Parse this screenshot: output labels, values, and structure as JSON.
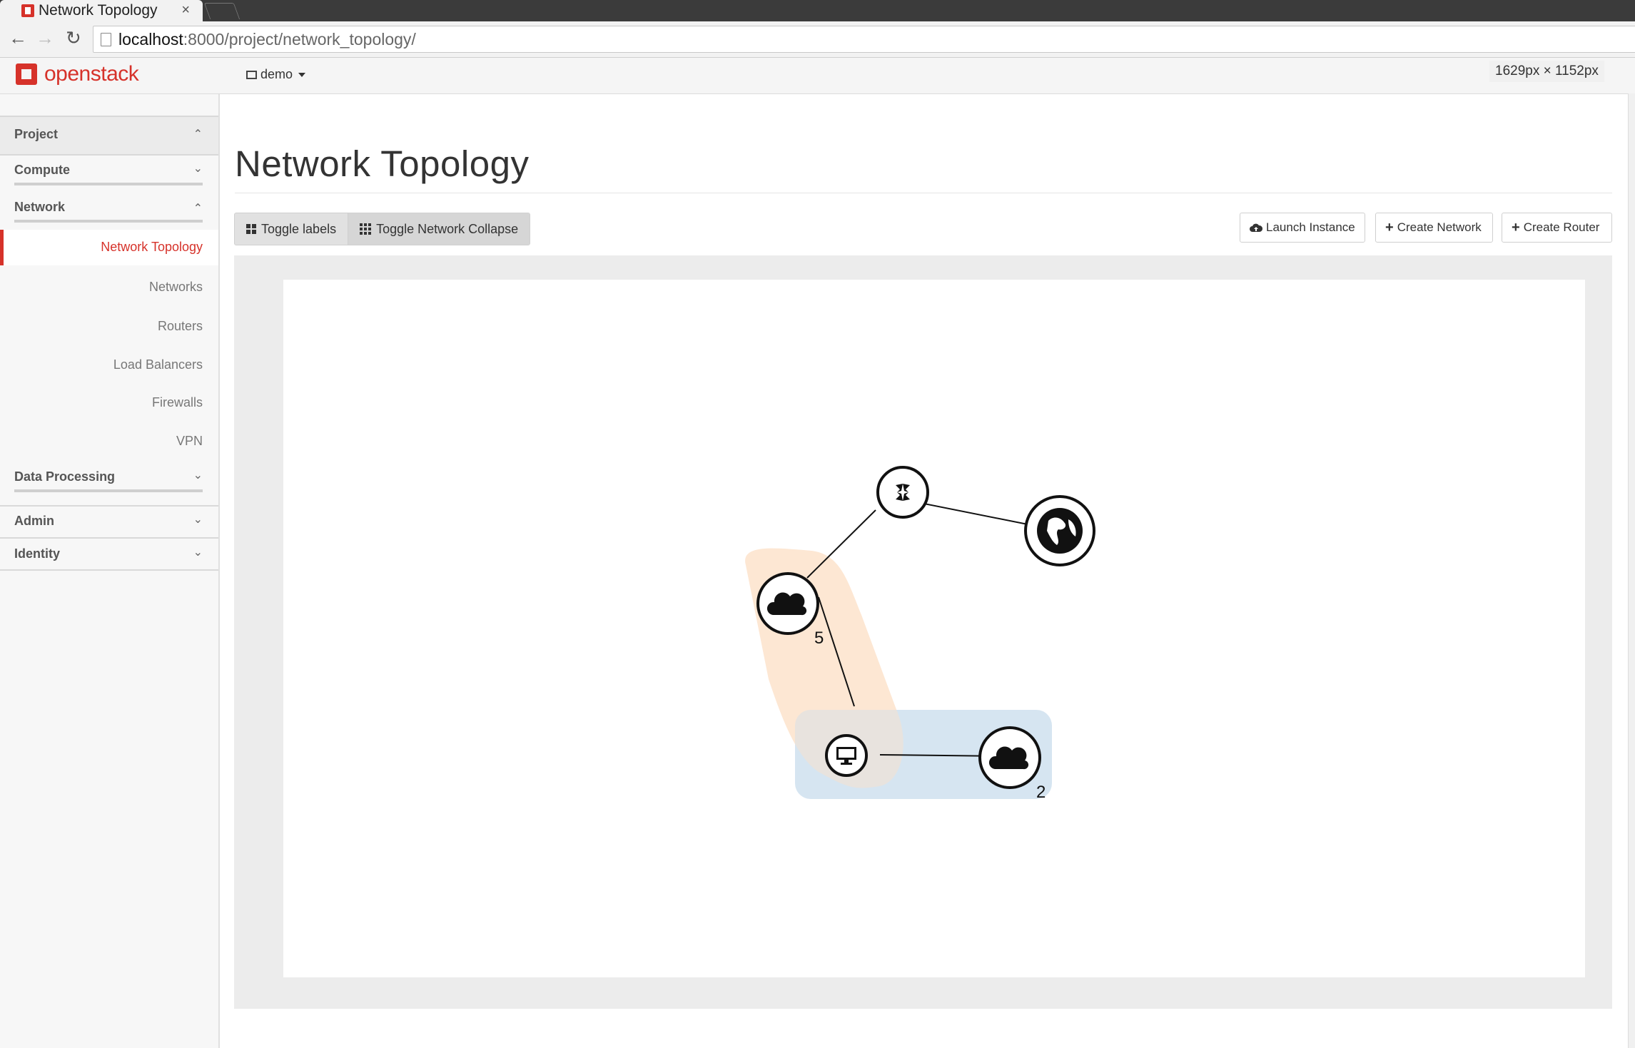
{
  "browser": {
    "tab_title": "Network Topology",
    "tab_close": "×",
    "url_host": "localhost",
    "url_path": ":8000/project/network_topology/"
  },
  "header": {
    "logo_text": "openstack",
    "project": "demo",
    "dimensions": "1629px × 1152px"
  },
  "sidebar": {
    "sections": {
      "project": "Project",
      "compute": "Compute",
      "network": "Network",
      "data_processing": "Data Processing",
      "admin": "Admin",
      "identity": "Identity"
    },
    "network_items": [
      "Network Topology",
      "Networks",
      "Routers",
      "Load Balancers",
      "Firewalls",
      "VPN"
    ]
  },
  "main": {
    "title": "Network Topology",
    "toggle_labels": "Toggle labels",
    "toggle_collapse": "Toggle Network Collapse",
    "launch_instance": "Launch Instance",
    "create_network": "Create Network",
    "create_router": "Create Router"
  },
  "topology": {
    "network_a_count": "5",
    "network_b_count": "2",
    "colors": {
      "network_a": "#fde4cf",
      "network_b": "#cfe0ee"
    }
  }
}
